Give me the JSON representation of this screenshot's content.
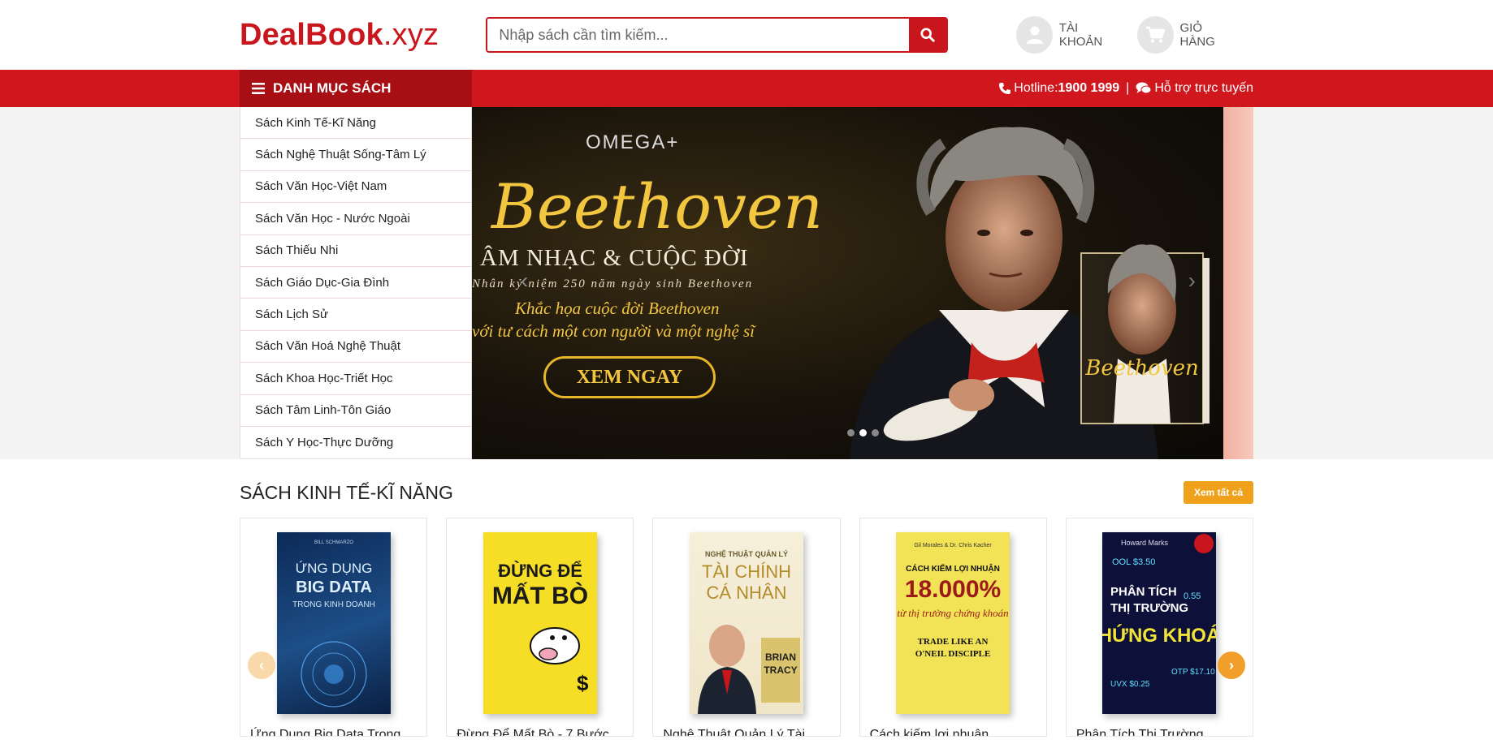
{
  "header": {
    "logo_main": "DealBook",
    "logo_tld": ".xyz",
    "search_placeholder": "Nhập sách cần tìm kiếm...",
    "account_label": "TÀI KHOẢN",
    "cart_label": "GIỎ HÀNG"
  },
  "nav": {
    "category_title": "DANH MỤC SÁCH",
    "hotline_label": "Hotline:",
    "hotline_number": "1900 1999",
    "support_label": "Hỗ trợ trực tuyến"
  },
  "categories": [
    "Sách Kinh Tế-Kĩ Năng",
    "Sách Nghệ Thuật Sống-Tâm Lý",
    "Sách Văn Học-Việt Nam",
    "Sách Văn Học - Nước Ngoài",
    "Sách Thiếu Nhi",
    "Sách Giáo Dục-Gia Đình",
    "Sách Lịch Sử",
    "Sách Văn Hoá Nghệ Thuật",
    "Sách Khoa Học-Triết Học",
    "Sách Tâm Linh-Tôn Giáo",
    "Sách Y Học-Thực Dưỡng"
  ],
  "banner": {
    "brand": "OMEGA+",
    "title": "Beethoven",
    "subtitle": "ÂM NHẠC & CUỘC ĐỜI",
    "tagline": "Nhân kỷ niệm 250 năm ngày sinh Beethoven",
    "desc_line1": "Khắc họa cuộc đời Beethoven",
    "desc_line2": "với tư cách một con người và một nghệ sĩ",
    "cta": "XEM NGAY",
    "slides": 3,
    "active_slide": 2
  },
  "section": {
    "title": "SÁCH KINH TẾ-KĨ NĂNG",
    "see_all": "Xem tất cả"
  },
  "products": [
    {
      "title": "Ứng Dụng Big Data Trong",
      "cover_line1": "ỨNG DỤNG",
      "cover_line2": "BIG DATA",
      "cover_line3": "TRONG KINH DOANH"
    },
    {
      "title": "Đừng Để Mất Bò - 7 Bước",
      "cover_line1": "ĐỪNG ĐỂ",
      "cover_line2": "MẤT BÒ",
      "cover_line3": ""
    },
    {
      "title": "Nghệ Thuật Quản Lý Tài",
      "cover_line1": "NGHỆ THUẬT QUẢN LÝ",
      "cover_line2": "TÀI CHÍNH",
      "cover_line3": "CÁ NHÂN"
    },
    {
      "title": "Cách kiếm lợi nhuận",
      "cover_line1": "CÁCH KIẾM LỢI NHUẬN",
      "cover_line2": "18.000%",
      "cover_line3": "từ thị trường chứng khoán"
    },
    {
      "title": "Phân Tích Thị Trường",
      "cover_line1": "PHÂN TÍCH",
      "cover_line2": "THỊ TRƯỜNG",
      "cover_line3": "CHỨNG KHOÁN"
    }
  ],
  "colors": {
    "brand_red": "#c9161c",
    "nav_red": "#d0171e",
    "accent_orange": "#f0a11b"
  }
}
